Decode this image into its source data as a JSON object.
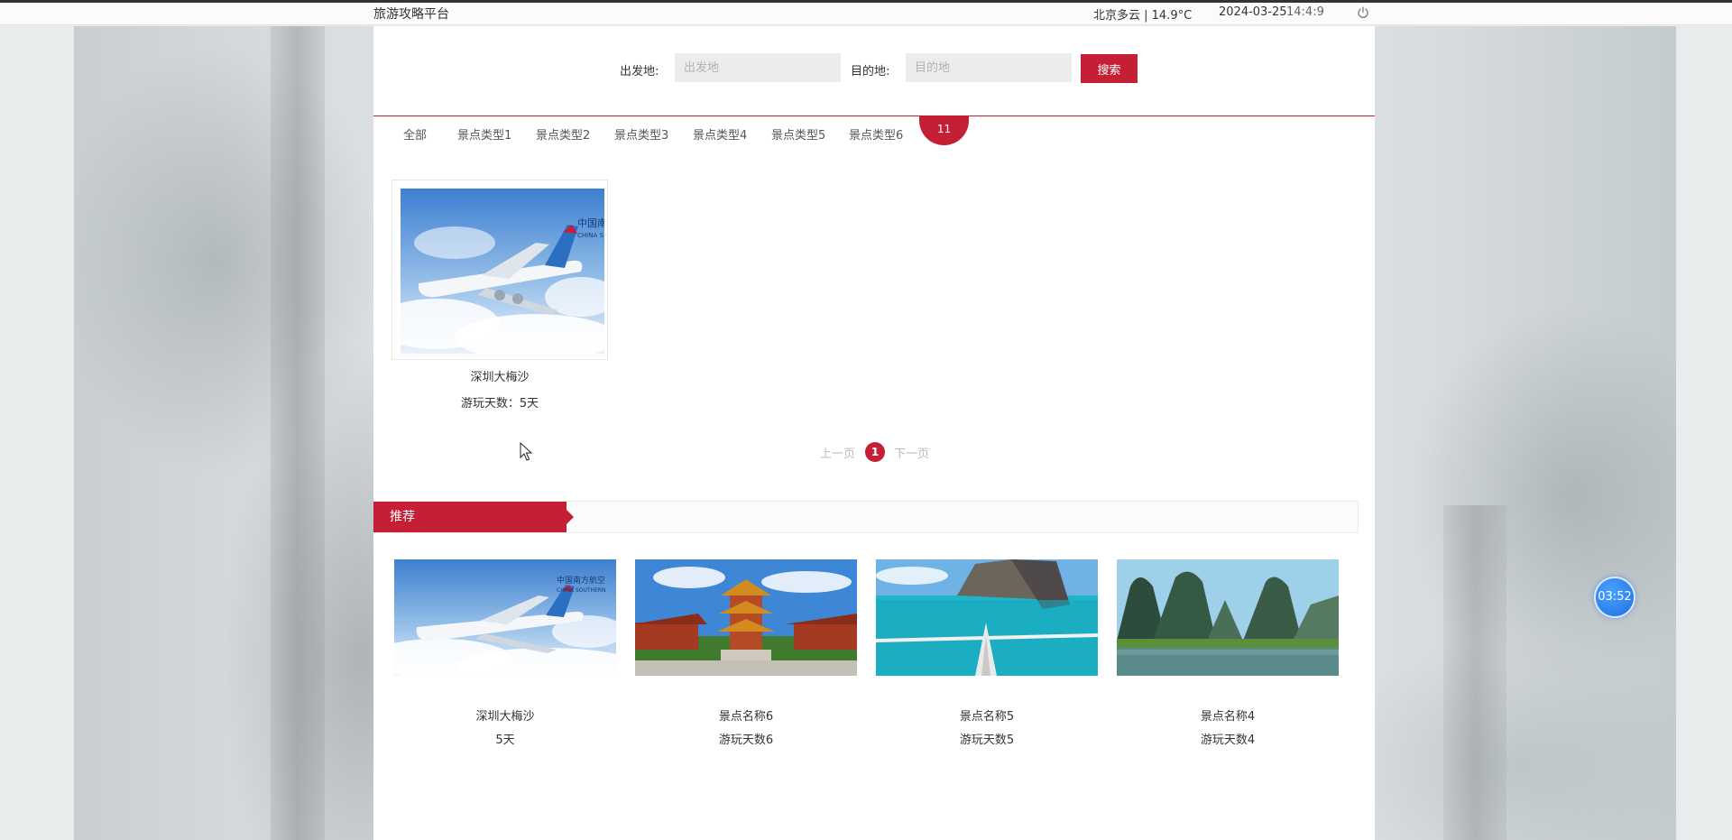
{
  "topbar": {
    "site_title": "旅游攻略平台",
    "weather": "北京多云 | 14.9°C",
    "date": "2024-03-25",
    "time": "14:4:9"
  },
  "search": {
    "from_label": "出发地:",
    "from_placeholder": "出发地",
    "from_value": "",
    "to_label": "目的地:",
    "to_placeholder": "目的地",
    "to_value": "",
    "button_label": "搜索"
  },
  "categories": {
    "items": [
      "全部",
      "景点类型1",
      "景点类型2",
      "景点类型3",
      "景点类型4",
      "景点类型5",
      "景点类型6"
    ],
    "badge": "11"
  },
  "listing": {
    "items": [
      {
        "name": "深圳大梅沙",
        "days_label": "游玩天数：5天",
        "image": "airplane-photo"
      }
    ]
  },
  "pagination": {
    "prev_label": "上一页",
    "current_page": "1",
    "next_label": "下一页"
  },
  "recommend": {
    "title": "推荐",
    "items": [
      {
        "name": "深圳大梅沙",
        "days": "5天",
        "image": "airplane-photo"
      },
      {
        "name": "景点名称6",
        "days": "游玩天数6",
        "image": "pagoda-photo"
      },
      {
        "name": "景点名称5",
        "days": "游玩天数5",
        "image": "boat-sea-photo"
      },
      {
        "name": "景点名称4",
        "days": "游玩天数4",
        "image": "karst-river-photo"
      }
    ]
  },
  "timer": {
    "label": "03:52"
  },
  "colors": {
    "accent": "#c41f34",
    "timer_blue": "#1e6fe0"
  },
  "icons": {
    "power": "power-icon",
    "cursor": "mouse-cursor-icon"
  }
}
